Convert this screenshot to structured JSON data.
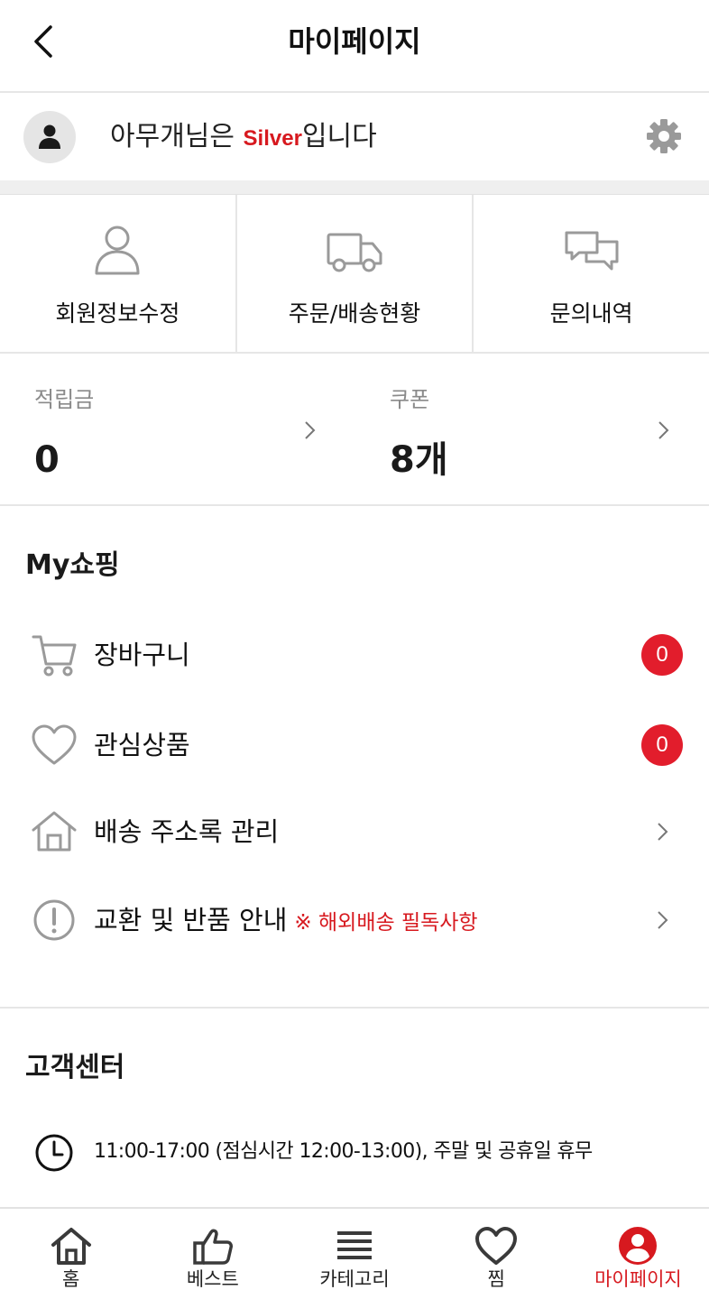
{
  "header": {
    "title": "마이페이지",
    "back_icon": "chevron-left-icon"
  },
  "profile": {
    "greeting_prefix": "아무개님은 ",
    "grade": "Silver",
    "greeting_suffix": "입니다",
    "avatar_icon": "person-icon",
    "settings_icon": "gear-icon"
  },
  "quick_menu": [
    {
      "label": "회원정보수정",
      "icon": "user-outline-icon"
    },
    {
      "label": "주문/배송현황",
      "icon": "truck-icon"
    },
    {
      "label": "문의내역",
      "icon": "chat-bubbles-icon"
    }
  ],
  "points": {
    "mileage_label": "적립금",
    "mileage_value": "0",
    "coupon_label": "쿠폰",
    "coupon_value": "8개"
  },
  "my_shopping": {
    "title": "My쇼핑",
    "items": [
      {
        "label": "장바구니",
        "icon": "cart-icon",
        "badge": "0"
      },
      {
        "label": "관심상품",
        "icon": "heart-outline-icon",
        "badge": "0"
      },
      {
        "label": "배송 주소록 관리",
        "icon": "house-icon"
      },
      {
        "label": "교환 및 반품 안내",
        "note": "※ 해외배송 필독사항",
        "icon": "exclamation-circle-icon"
      }
    ]
  },
  "customer_center": {
    "title": "고객센터",
    "hours": "11:00-17:00 (점심시간 12:00-13:00), 주말 및 공휴일 휴무",
    "hours_icon": "clock-icon"
  },
  "tabbar": [
    {
      "label": "홈",
      "icon": "home-icon",
      "active": false
    },
    {
      "label": "베스트",
      "icon": "thumbs-up-icon",
      "active": false
    },
    {
      "label": "카테고리",
      "icon": "menu-lines-icon",
      "active": false
    },
    {
      "label": "찜",
      "icon": "heart-icon",
      "active": false
    },
    {
      "label": "마이페이지",
      "icon": "user-circle-icon",
      "active": true
    }
  ],
  "colors": {
    "accent": "#d7191f",
    "badge": "#e21d2c",
    "icon_gray": "#9a9a9a",
    "divider": "#e6e6e6"
  }
}
